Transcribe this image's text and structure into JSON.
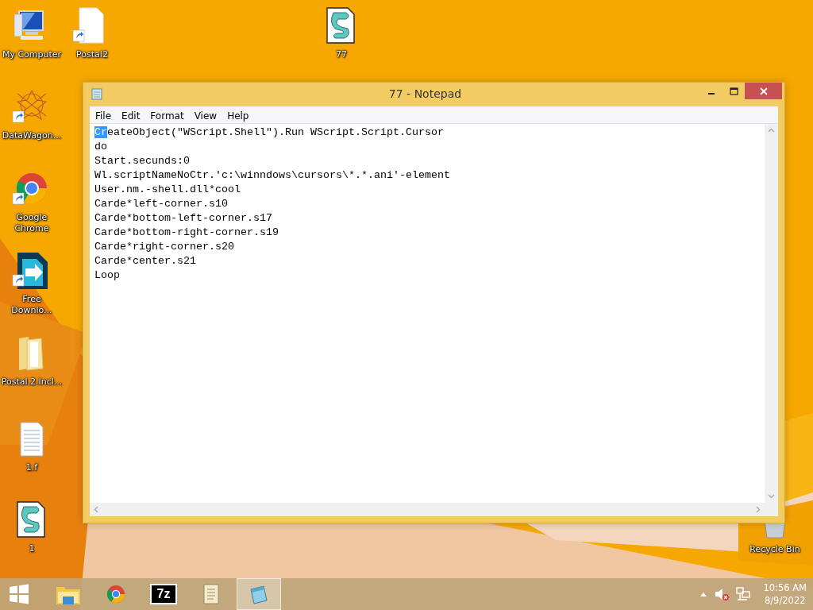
{
  "desktop_icons": [
    {
      "label": "My Computer",
      "shortcut": false
    },
    {
      "label": "Postal2",
      "shortcut": true
    },
    {
      "label": "77",
      "shortcut": false
    },
    {
      "label": "DataWagon...",
      "shortcut": true
    },
    {
      "label": "Google Chrome",
      "shortcut": true
    },
    {
      "label": "Free Downlo...",
      "shortcut": true
    },
    {
      "label": "Postal.2.Incl...",
      "shortcut": false
    },
    {
      "label": "1.f",
      "shortcut": false
    },
    {
      "label": "1",
      "shortcut": false
    },
    {
      "label": "Recycle Bin",
      "shortcut": false
    }
  ],
  "window": {
    "title": "77 - Notepad",
    "menu": [
      "File",
      "Edit",
      "Format",
      "View",
      "Help"
    ],
    "lines": [
      {
        "selected_text": "Cr",
        "text": "eateObject(\"WScript.Shell\").Run WScript.Script.Cursor"
      },
      {
        "text": "do"
      },
      {
        "text": "Start.secunds:0"
      },
      {
        "text": "Wl.scriptNameNoCtr.'c:\\winndows\\cursors\\*.*.ani'-element"
      },
      {
        "text": "User.nm.-shell.dll*cool"
      },
      {
        "text": "Carde*left-corner.s10"
      },
      {
        "text": "Carde*bottom-left-corner.s17"
      },
      {
        "text": "Carde*bottom-right-corner.s19"
      },
      {
        "text": "Carde*right-corner.s20"
      },
      {
        "text": "Carde*center.s21"
      },
      {
        "text": "Loop"
      }
    ]
  },
  "taskbar": {
    "apps": [
      {
        "selected": false
      },
      {
        "selected": false
      },
      {
        "text": "7z",
        "selected": false
      },
      {
        "selected": false
      },
      {
        "selected": true
      }
    ],
    "clock": {
      "time": "10:56 AM",
      "date": "8/9/2022"
    }
  }
}
